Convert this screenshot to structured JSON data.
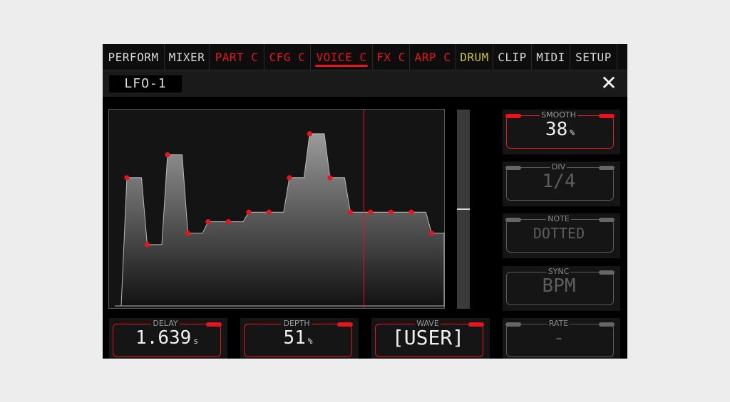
{
  "tabs": [
    {
      "label": "PERFORM",
      "color": "#d8d8d8",
      "active": false
    },
    {
      "label": "MIXER",
      "color": "#d8d8d8",
      "active": false
    },
    {
      "label": "PART C",
      "color": "#e8141e",
      "active": false
    },
    {
      "label": "CFG C",
      "color": "#e8141e",
      "active": false
    },
    {
      "label": "VOICE C",
      "color": "#e8141e",
      "active": true
    },
    {
      "label": "FX C",
      "color": "#e8141e",
      "active": false
    },
    {
      "label": "ARP C",
      "color": "#e8141e",
      "active": false
    },
    {
      "label": "DRUM",
      "color": "#c9c23a",
      "active": false
    },
    {
      "label": "CLIP",
      "color": "#d8d8d8",
      "active": false
    },
    {
      "label": "MIDI",
      "color": "#d8d8d8",
      "active": false
    },
    {
      "label": "SETUP",
      "color": "#d8d8d8",
      "active": false
    }
  ],
  "header": {
    "title": "LFO-1",
    "close_glyph": "✕"
  },
  "lfo_wave": {
    "accent": "#e8141e",
    "level_max": 1.0,
    "steps": [
      0.67,
      0.32,
      0.79,
      0.38,
      0.44,
      0.44,
      0.49,
      0.49,
      0.67,
      0.9,
      0.67,
      0.49,
      0.49,
      0.49,
      0.49,
      0.38
    ],
    "playhead_fraction": 0.76,
    "scroll_position": 0.5
  },
  "controls": {
    "smooth": {
      "label": "SMOOTH",
      "value": "38",
      "unit": "%",
      "active": true
    },
    "div": {
      "label": "DIV",
      "value": "1/4",
      "unit": "",
      "active": false
    },
    "note": {
      "label": "NOTE",
      "value": "DOTTED",
      "unit": "",
      "active": false
    },
    "sync": {
      "label": "SYNC",
      "value": "BPM",
      "unit": "",
      "active": false
    },
    "rate": {
      "label": "RATE",
      "value": "-",
      "unit": "",
      "active": false
    },
    "delay": {
      "label": "DELAY",
      "value": "1.639",
      "unit": "s",
      "active": true
    },
    "depth": {
      "label": "DEPTH",
      "value": "51",
      "unit": "%",
      "active": true
    },
    "wave": {
      "label": "WAVE",
      "value": "[USER]",
      "unit": "",
      "active": true
    }
  },
  "colors": {
    "accent": "#e8141e",
    "drum": "#c9c23a",
    "text": "#d8d8d8"
  }
}
